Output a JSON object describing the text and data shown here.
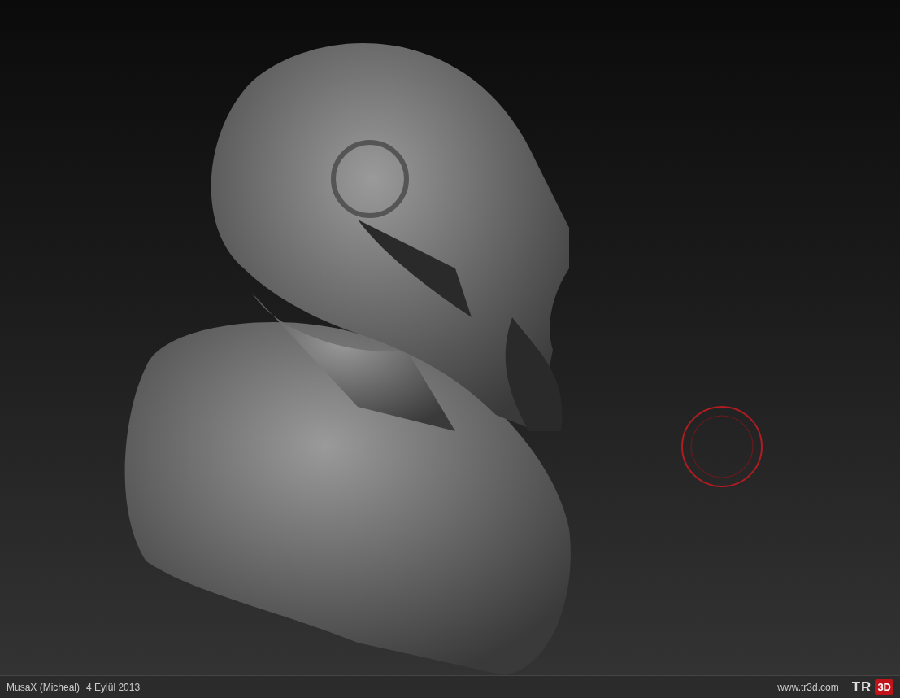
{
  "viewport": {
    "brush_cursor": true
  },
  "footer": {
    "caption": "MusaX (Micheal)",
    "date": "4 Eylül 2013",
    "site": "www.tr3d.com",
    "logo_left": "TR",
    "logo_right": "3D"
  }
}
